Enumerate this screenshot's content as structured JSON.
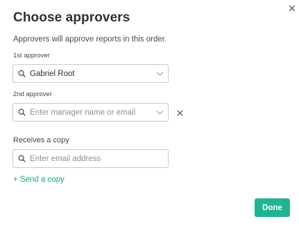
{
  "dialog": {
    "title": "Choose approvers",
    "subtitle": "Approvers will approve reports in this order."
  },
  "approver1": {
    "label": "1st approver",
    "value": "Gabriel Root"
  },
  "approver2": {
    "label": "2nd approver",
    "placeholder": "Enter manager name or email"
  },
  "copy": {
    "label": "Receives a copy",
    "placeholder": "Enter email address",
    "send_link": "+ Send a copy"
  },
  "actions": {
    "done_label": "Done"
  },
  "colors": {
    "accent": "#1fb396",
    "link": "#1aa88a"
  },
  "icons": {
    "close": "close-icon",
    "search": "search-icon",
    "dropdown": "chevron-down-icon",
    "remove": "remove-icon"
  }
}
